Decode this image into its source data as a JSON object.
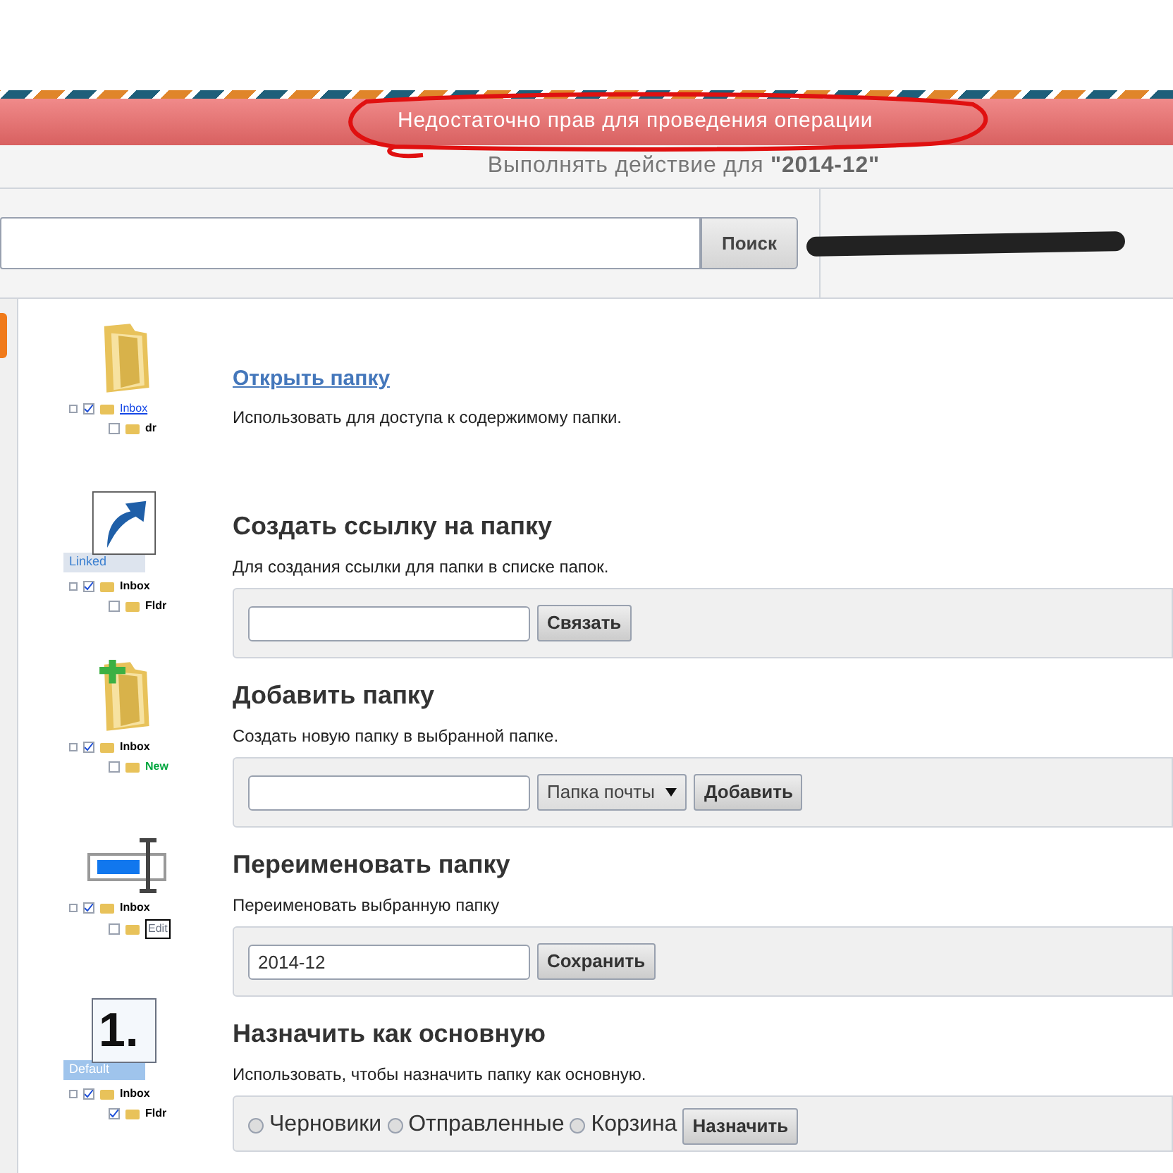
{
  "error_banner": {
    "message": "Недостаточно прав для проведения операции"
  },
  "target": {
    "prefix": "Выполнять действие для ",
    "name": "\"2014-12\""
  },
  "search": {
    "button": "Поиск"
  },
  "actions": [
    {
      "kind": "open",
      "title": "Открыть папку",
      "link": true,
      "description": "Использовать для доступа к содержимому папки.",
      "illustration": {
        "tree": [
          {
            "label": "Inbox",
            "checked": true
          },
          {
            "label": "dr",
            "checked": false
          }
        ]
      }
    },
    {
      "kind": "link",
      "title": "Создать ссылку на папку",
      "link": false,
      "description": "Для создания ссылки для папки в списке папок.",
      "illustration": {
        "badge": "Linked",
        "tree": [
          {
            "label": "Inbox",
            "checked": true
          },
          {
            "label": "Fldr",
            "checked": false
          }
        ]
      },
      "form": {
        "button": "Связать"
      }
    },
    {
      "kind": "add",
      "title": "Добавить папку",
      "link": false,
      "description": "Создать новую папку в выбранной папке.",
      "illustration": {
        "tree": [
          {
            "label": "Inbox",
            "checked": true
          },
          {
            "label": "New",
            "checked": false
          }
        ]
      },
      "form": {
        "select": "Папка почты",
        "button": "Добавить"
      }
    },
    {
      "kind": "rename",
      "title": "Переименовать папку",
      "link": false,
      "description": "Переименовать выбранную папку",
      "illustration": {
        "tree": [
          {
            "label": "Inbox",
            "checked": true
          },
          {
            "label": "Edit",
            "checked": false
          }
        ]
      },
      "form": {
        "value": "2014-12",
        "button": "Сохранить"
      }
    },
    {
      "kind": "default",
      "title": "Назначить как основную",
      "link": false,
      "description": "Использовать, чтобы назначить папку как основную.",
      "illustration": {
        "badge": "Default",
        "number": "1.",
        "tree": [
          {
            "label": "Inbox",
            "checked": true
          },
          {
            "label": "Fldr",
            "checked": true
          }
        ]
      },
      "radios": [
        {
          "label": "Черновики",
          "selected": false
        },
        {
          "label": "Отправленные",
          "selected": false
        },
        {
          "label": "Корзина",
          "selected": false
        }
      ],
      "radio_button": "Назначить"
    }
  ]
}
